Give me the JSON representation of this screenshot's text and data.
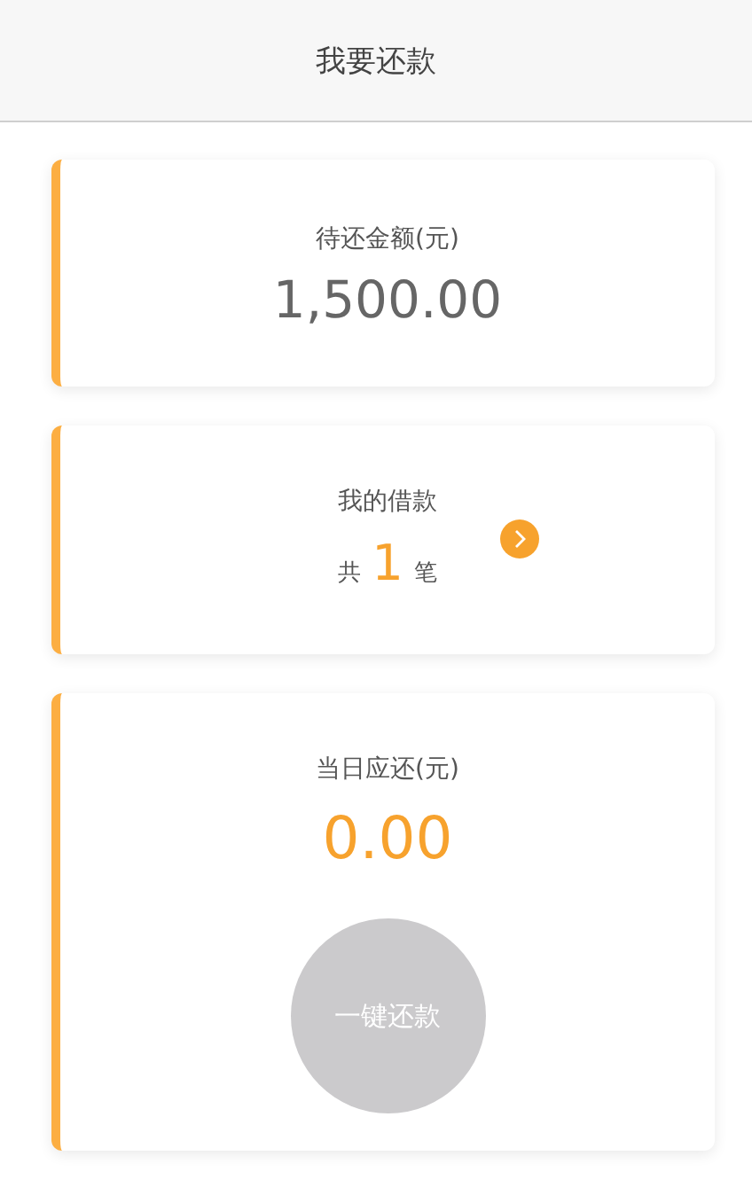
{
  "header": {
    "title": "我要还款"
  },
  "cards": [
    {
      "kind": "total",
      "label": "待还金额(元)",
      "amount": "1,500.00"
    },
    {
      "kind": "loans",
      "label": "我的借款",
      "prefix": "共",
      "count": "1",
      "suffix": "笔"
    },
    {
      "kind": "due",
      "label": "当日应还(元)",
      "amount": "0.00",
      "button": {
        "label": "一键还款",
        "disabled": true
      }
    }
  ]
}
